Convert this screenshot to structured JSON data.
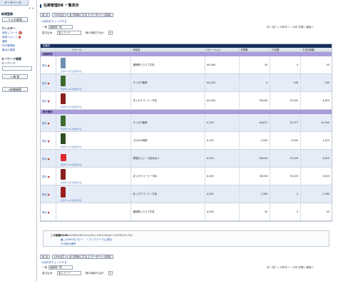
{
  "sidebar": {
    "tab": "データベース",
    "arrows": "< >",
    "new_section": "新規登録",
    "new_button": "＋入力画面",
    "filter_section": "フィルター",
    "filter_links": [
      {
        "label": "削除レコード",
        "badge": "29"
      },
      {
        "label": "承認コメント",
        "badge": "5"
      },
      {
        "label": "通知",
        "badge": ""
      },
      {
        "label": "PDF管理者",
        "badge": ""
      },
      {
        "label": "最近の更新",
        "badge": ""
      }
    ],
    "keyword_section": "キーワード検索",
    "keyword_label": "キーワード",
    "search_button": "検 索",
    "advanced_button": "詳細検索"
  },
  "header": {
    "title": "在庫管理DB ー覧表示",
    "toolbar": [
      "戻 る",
      "CSV出力",
      "全て削除にする",
      "データベース設定"
    ],
    "check_all": "全件をチェックする",
    "view_label": "一覧",
    "view_value": "画面用一覧",
    "sort_label": "並び込み",
    "sort_value": "全レコード",
    "count_label": "個人用絞り込み",
    "pager": "次へ 前へ | 15件中 1 - 15件 先頭へ 最後へ"
  },
  "table": {
    "bar_label": "品番名",
    "columns": [
      "",
      "イメージ",
      "商品名",
      "ロケーション",
      "在庫数",
      "引当数",
      "引当可能数"
    ],
    "display_link": "表示",
    "image_link": "元のサイズで表示する",
    "groups": [
      {
        "name": "乳飲料等",
        "rows": [
          {
            "product": "福岡県とうとて牛乳",
            "location": "AA-500",
            "stock": "40",
            "reserved": "0",
            "available": "40",
            "image": "bottle-blue",
            "color": "#6f8fb0"
          },
          {
            "product": "すっきり酸味",
            "location": "AA-202",
            "stock": "0",
            "reserved": "-240",
            "available": "240",
            "image": "bottle-green",
            "color": "#3d6b2e"
          },
          {
            "product": "まったりコーヒー牛乳",
            "location": "AA-400",
            "stock": "38,040",
            "reserved": "33,220",
            "available": "4,820",
            "image": "bottle-red",
            "color": "#8a1f1f"
          }
        ]
      },
      {
        "name": "果汁飲料",
        "rows": [
          {
            "product": "すっきり酸味",
            "location": "A-100",
            "stock": "46,817",
            "reserved": "32,477",
            "available": "14,340",
            "image": "bottle-green",
            "color": "#3d6b2e"
          },
          {
            "product": "さわやか緑茶",
            "location": "A-101",
            "stock": "-2,590",
            "reserved": "-4,000",
            "available": "1,410",
            "image": "bottle-green",
            "color": "#2f4f23"
          },
          {
            "product": "薄型生ジュース飲み比べ",
            "location": "A-300",
            "stock": "38,040",
            "reserved": "33,220",
            "available": "4,820",
            "image": "cup-red",
            "color": "#e0282e"
          },
          {
            "product": "まったりコーヒー牛乳",
            "location": "A-400",
            "stock": "38,040",
            "reserved": "33,220",
            "available": "4,820",
            "image": "bottle-red",
            "color": "#8a1f1f"
          },
          {
            "product": "あっさりコーヒー牛乳",
            "location": "A-401",
            "stock": "2,280",
            "reserved": "0",
            "available": "2,280",
            "image": "can-red",
            "color": "#9b1c1c"
          },
          {
            "product": "福岡県とうとて牛乳",
            "location": "A-500",
            "stock": "40",
            "reserved": "0",
            "available": "40",
            "image": "none",
            "color": ""
          }
        ]
      }
    ]
  },
  "url_section": {
    "label": "この画面のURL",
    "url": "/SCB/SCB0102.jsf?p=100220&g2=2010&23=241",
    "copy_link": "このURLをコピー",
    "bookmark_link": "ブックマークに追加",
    "other_link": "その他の操作"
  }
}
